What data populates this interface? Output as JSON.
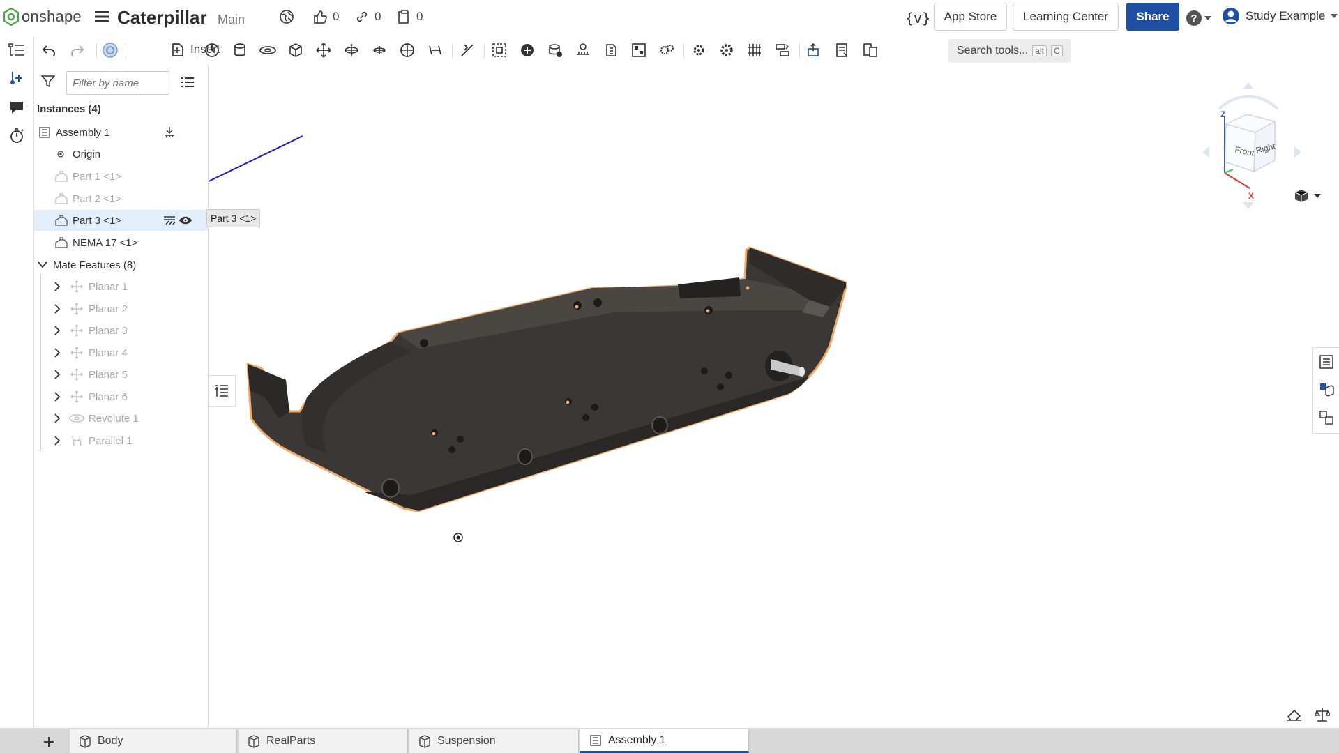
{
  "app": {
    "name": "onshape",
    "document_title": "Caterpillar",
    "branch": "Main"
  },
  "topbar": {
    "likes": "0",
    "links": "0",
    "copies": "0",
    "variables_label": "{v}",
    "app_store": "App Store",
    "learning_center": "Learning Center",
    "share": "Share",
    "user": "Study Example"
  },
  "toolbar": {
    "insert": "Insert",
    "search_placeholder": "Search tools...",
    "search_shortcut_1": "alt",
    "search_shortcut_2": "C"
  },
  "panel": {
    "filter_placeholder": "Filter by name",
    "instances_header": "Instances (4)",
    "assembly": "Assembly 1",
    "origin": "Origin",
    "instances": [
      {
        "label": "Part 1 <1>",
        "hidden": true
      },
      {
        "label": "Part 2 <1>",
        "hidden": true
      },
      {
        "label": "Part 3 <1>",
        "hidden": false,
        "selected": true
      },
      {
        "label": "NEMA 17 <1>",
        "hidden": false
      }
    ],
    "mate_header": "Mate Features (8)",
    "mates": [
      {
        "label": "Planar 1",
        "icon": "planar-mate-icon"
      },
      {
        "label": "Planar 2",
        "icon": "planar-mate-icon"
      },
      {
        "label": "Planar 3",
        "icon": "planar-mate-icon"
      },
      {
        "label": "Planar 4",
        "icon": "planar-mate-icon"
      },
      {
        "label": "Planar 5",
        "icon": "planar-mate-icon"
      },
      {
        "label": "Planar 6",
        "icon": "planar-mate-icon"
      },
      {
        "label": "Revolute 1",
        "icon": "revolute-mate-icon"
      },
      {
        "label": "Parallel 1",
        "icon": "parallel-mate-icon"
      }
    ],
    "tooltip": "Part 3 <1>"
  },
  "viewcube": {
    "front": "Front",
    "right": "Right",
    "axis_z": "Z",
    "axis_x": "X"
  },
  "tabs": [
    {
      "label": "Body",
      "active": false
    },
    {
      "label": "RealParts",
      "active": false
    },
    {
      "label": "Suspension",
      "active": false
    },
    {
      "label": "Assembly 1",
      "active": true
    }
  ],
  "colors": {
    "accent": "#1f4fa3",
    "selection": "#e3eefc",
    "part_body": "#3d3a37",
    "highlight_edge": "#f0a868",
    "annotation_arrow": "#1a1ad4"
  }
}
